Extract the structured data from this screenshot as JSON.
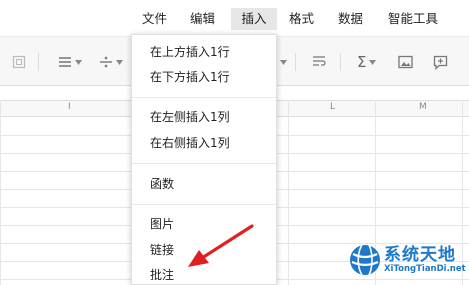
{
  "menubar": {
    "items": [
      {
        "label": "文件"
      },
      {
        "label": "编辑"
      },
      {
        "label": "插入"
      },
      {
        "label": "格式"
      },
      {
        "label": "数据"
      },
      {
        "label": "智能工具"
      }
    ],
    "active_index": 2
  },
  "toolbar": {
    "icons": [
      "frame-icon",
      "align-icon",
      "divide-icon",
      "wrap-icon",
      "sum-icon",
      "image-icon",
      "comment-add-icon"
    ]
  },
  "sheet": {
    "column_letters": [
      "I",
      "L",
      "M"
    ]
  },
  "insert_menu": {
    "items": [
      {
        "label": "在上方插入1行"
      },
      {
        "label": "在下方插入1行"
      },
      {
        "label": "在左侧插入1列"
      },
      {
        "label": "在右侧插入1列"
      },
      {
        "label": "函数"
      },
      {
        "label": "图片"
      },
      {
        "label": "链接"
      },
      {
        "label": "批注"
      }
    ]
  },
  "annotation": {
    "color": "#e02020"
  },
  "watermark": {
    "title": "系统天地",
    "subtitle": "XiTongTianDi.net",
    "color": "#1e79c9"
  }
}
